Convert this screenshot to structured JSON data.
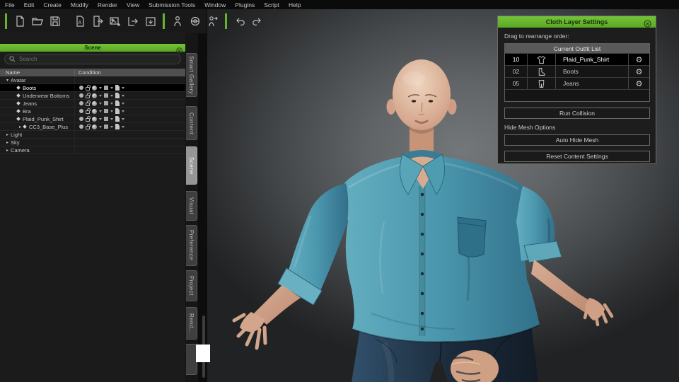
{
  "window": {
    "menu_items": [
      "File",
      "Edit",
      "Create",
      "Modify",
      "Render",
      "View",
      "Submission Tools",
      "Window",
      "Plugins",
      "Script",
      "Help"
    ]
  },
  "toolbar": {
    "groups": [
      [
        "new-project-icon",
        "open-project-icon",
        "save-project-icon"
      ],
      [
        "import-document-icon",
        "export-document-icon",
        "image-export-icon",
        "export-icon",
        "content-pack-icon"
      ],
      [
        "character-icon",
        "camera-globe-icon",
        "pose-icon"
      ],
      [
        "undo-icon",
        "redo-icon"
      ]
    ]
  },
  "scene_panel": {
    "title": "Scene",
    "search_placeholder": "Search",
    "columns": [
      "Name",
      "Condition"
    ],
    "condition_icons": [
      "visibility-icon",
      "lock-icon",
      "material-sphere-icon",
      "mesh-cube-icon",
      "script-page-icon"
    ],
    "rows": [
      {
        "label": "Avatar",
        "level": 0,
        "expander": "down",
        "bullet": false,
        "selected": false,
        "icons": false
      },
      {
        "label": "Boots",
        "level": 1,
        "expander": "none",
        "bullet": true,
        "selected": true,
        "icons": true
      },
      {
        "label": "Underwear Bottoms",
        "level": 1,
        "expander": "none",
        "bullet": true,
        "selected": false,
        "icons": true
      },
      {
        "label": "Jeans",
        "level": 1,
        "expander": "none",
        "bullet": true,
        "selected": false,
        "icons": true
      },
      {
        "label": "Bra",
        "level": 1,
        "expander": "none",
        "bullet": true,
        "selected": false,
        "icons": true
      },
      {
        "label": "Plaid_Punk_Shirt",
        "level": 1,
        "expander": "none",
        "bullet": true,
        "selected": false,
        "icons": true
      },
      {
        "label": "CC3_Base_Plus",
        "level": 1,
        "expander": "right",
        "bullet": true,
        "selected": false,
        "icons": true
      },
      {
        "label": "Light",
        "level": 0,
        "expander": "right",
        "bullet": false,
        "selected": false,
        "icons": false
      },
      {
        "label": "Sky",
        "level": 0,
        "expander": "right",
        "bullet": false,
        "selected": false,
        "icons": false
      },
      {
        "label": "Camera",
        "level": 0,
        "expander": "right",
        "bullet": false,
        "selected": false,
        "icons": false
      }
    ]
  },
  "side_tabs": [
    {
      "label": "Smart Gallery",
      "active": false
    },
    {
      "label": "Content",
      "active": false
    },
    {
      "label": "Scene",
      "active": true
    },
    {
      "label": "Visual",
      "active": false
    },
    {
      "label": "Preference",
      "active": false
    },
    {
      "label": "Project",
      "active": false
    },
    {
      "label": "Rend...",
      "active": false
    },
    {
      "label": "",
      "active": false
    }
  ],
  "cloth_panel": {
    "title": "Cloth Layer Settings",
    "drag_hint": "Drag to rearrange order:",
    "list_header": "Current Outfit List",
    "items": [
      {
        "order": "10",
        "icon": "shirt-icon",
        "label": "Plaid_Punk_Shirt",
        "selected": true
      },
      {
        "order": "02",
        "icon": "boot-icon",
        "label": "Boots",
        "selected": false
      },
      {
        "order": "05",
        "icon": "pants-icon",
        "label": "Jeans",
        "selected": false
      }
    ],
    "hide_mesh_label": "Hide Mesh Options",
    "buttons": {
      "run_collision": "Run Collision",
      "auto_hide_mesh": "Auto Hide Mesh",
      "reset_content": "Reset Content Settings"
    }
  },
  "colors": {
    "accent_green": "#6ab32d",
    "selection_black": "#000000",
    "shirt_teal": "#4a95ab",
    "jeans_blue": "#1c2c3d",
    "skin": "#d6a88f"
  }
}
